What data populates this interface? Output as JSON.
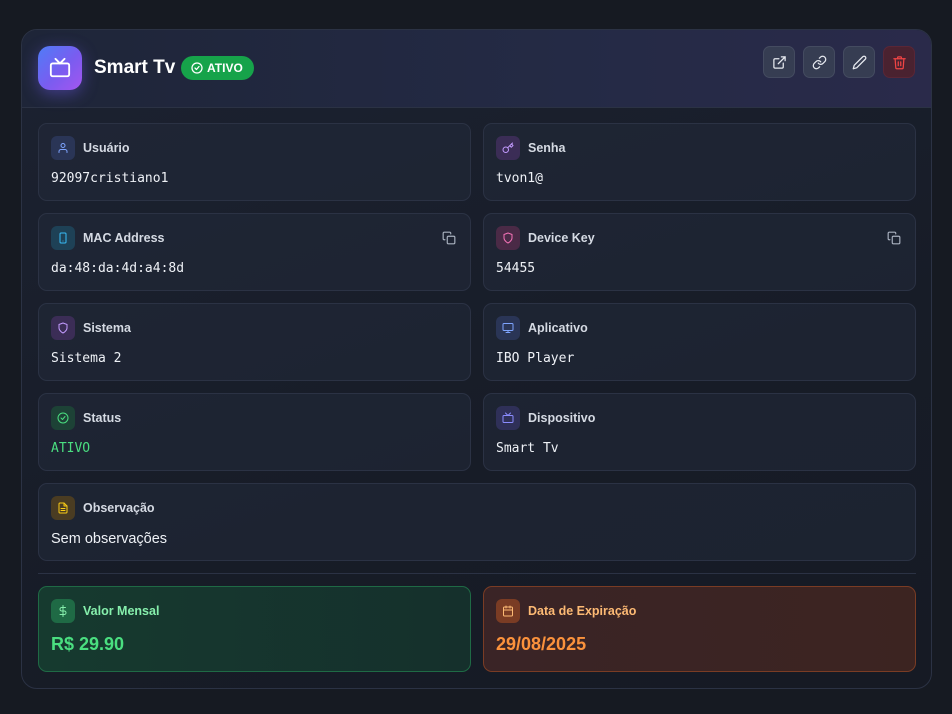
{
  "header": {
    "title": "Smart Tv",
    "status_badge": "ATIVO",
    "icon": "tv-icon",
    "actions": [
      "external-link-icon",
      "link-icon",
      "edit-icon",
      "trash-icon"
    ]
  },
  "fields": {
    "usuario": {
      "label": "Usuário",
      "value": "92097cristiano1",
      "icon": "user-icon"
    },
    "senha": {
      "label": "Senha",
      "value": "tvon1@",
      "icon": "key-icon"
    },
    "mac": {
      "label": "MAC Address",
      "value": "da:48:da:4d:a4:8d",
      "icon": "smartphone-icon"
    },
    "device_key": {
      "label": "Device Key",
      "value": "54455",
      "icon": "shield-icon"
    },
    "sistema": {
      "label": "Sistema",
      "value": "Sistema 2",
      "icon": "shield-icon"
    },
    "aplicativo": {
      "label": "Aplicativo",
      "value": "IBO Player",
      "icon": "monitor-icon"
    },
    "status": {
      "label": "Status",
      "value": "ATIVO",
      "icon": "check-circle-icon"
    },
    "dispositivo": {
      "label": "Dispositivo",
      "value": "Smart Tv",
      "icon": "tv-icon"
    },
    "observacao": {
      "label": "Observação",
      "value": "Sem observações",
      "icon": "file-text-icon"
    }
  },
  "billing": {
    "valor": {
      "label": "Valor Mensal",
      "value": "R$ 29.90",
      "icon": "dollar-icon"
    },
    "expiracao": {
      "label": "Data de Expiração",
      "value": "29/08/2025",
      "icon": "calendar-icon"
    }
  },
  "colors": {
    "accent": "#7a5cf0",
    "active_green": "#16a34a",
    "money_green": "#4ade80",
    "expiry_orange": "#fb923c",
    "danger_red": "#ef4444"
  }
}
